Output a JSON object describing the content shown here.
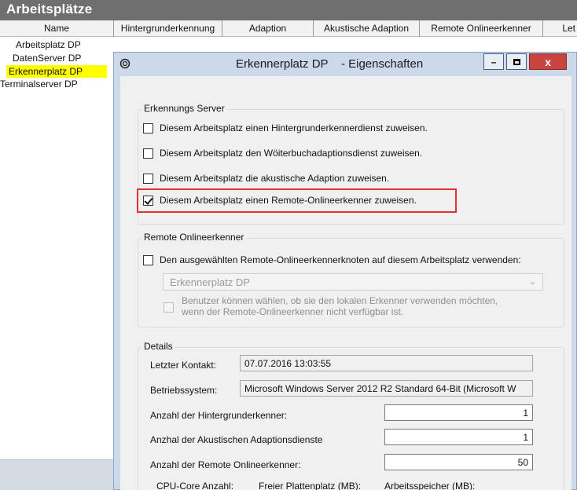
{
  "app": {
    "title": "Arbeitsplätze",
    "columns": [
      "Name",
      "Hintergrunderkennung",
      "Adaption",
      "Akustische Adaption",
      "Remote Onlineerkenner",
      "Let"
    ],
    "workstations": [
      {
        "label": "Arbeitsplatz DP",
        "selected": false
      },
      {
        "label": "DatenServer DP",
        "selected": false
      },
      {
        "label": "Erkennerplatz DP",
        "selected": true
      },
      {
        "label": "Terminalserver DP",
        "selected": false
      }
    ],
    "selection_color": "#ffff00"
  },
  "dialog": {
    "title": "Erkennerplatz DP    - Eigenschaften",
    "minimize_label": "–",
    "maximize_label": "▫",
    "close_label": "x",
    "server_group": {
      "label": "Erkennungs Server",
      "options": [
        {
          "label": "Diesem Arbeitsplatz einen Hintergrunderkennerdienst zuweisen.",
          "checked": false
        },
        {
          "label": "Diesem Arbeitsplatz den Wöiterbuchadaptionsdienst zuweisen.",
          "checked": false
        },
        {
          "label": "Diesem Arbeitsplatz die akustische Adaption zuweisen.",
          "checked": false
        },
        {
          "label": "Diesem Arbeitsplatz einen Remote-Onlineerkenner zuweisen.",
          "checked": true
        }
      ],
      "highlight_color": "#e03030"
    },
    "remote_group": {
      "label": "Remote Onlineerkenner",
      "use_node_label": "Den ausgewählten Remote-Onlineerkennerknoten auf diesem Arbeitsplatz verwenden:",
      "use_node_checked": false,
      "selected_node": "Erkennerplatz DP",
      "fallback_line1": "Benutzer können wählen, ob sie den lokalen Erkenner verwenden möchten,",
      "fallback_line2": "wenn der Remote-Onlineerkenner nicht verfügbar ist.",
      "fallback_checked": false
    },
    "details": {
      "label": "Details",
      "last_contact_label": "Letzter Kontakt:",
      "last_contact_value": "07.07.2016 13:03:55",
      "os_label": "Betriebssystem:",
      "os_value": "Microsoft Windows Server 2012 R2 Standard 64-Bit (Microsoft W",
      "background_count_label": "Anzahl der Hintergrunderkenner:",
      "background_count_value": "1",
      "acoustic_count_label": "Anzhal der Akustischen Adaptionsdienste",
      "acoustic_count_value": "1",
      "remote_count_label": "Anzahl der Remote Onlineerkenner:",
      "remote_count_value": "50",
      "cpu_label": "CPU-Core Anzahl:",
      "disk_label": "Freier Plattenplatz (MB):",
      "ram_label": "Arbeitsspeicher (MB):"
    }
  }
}
